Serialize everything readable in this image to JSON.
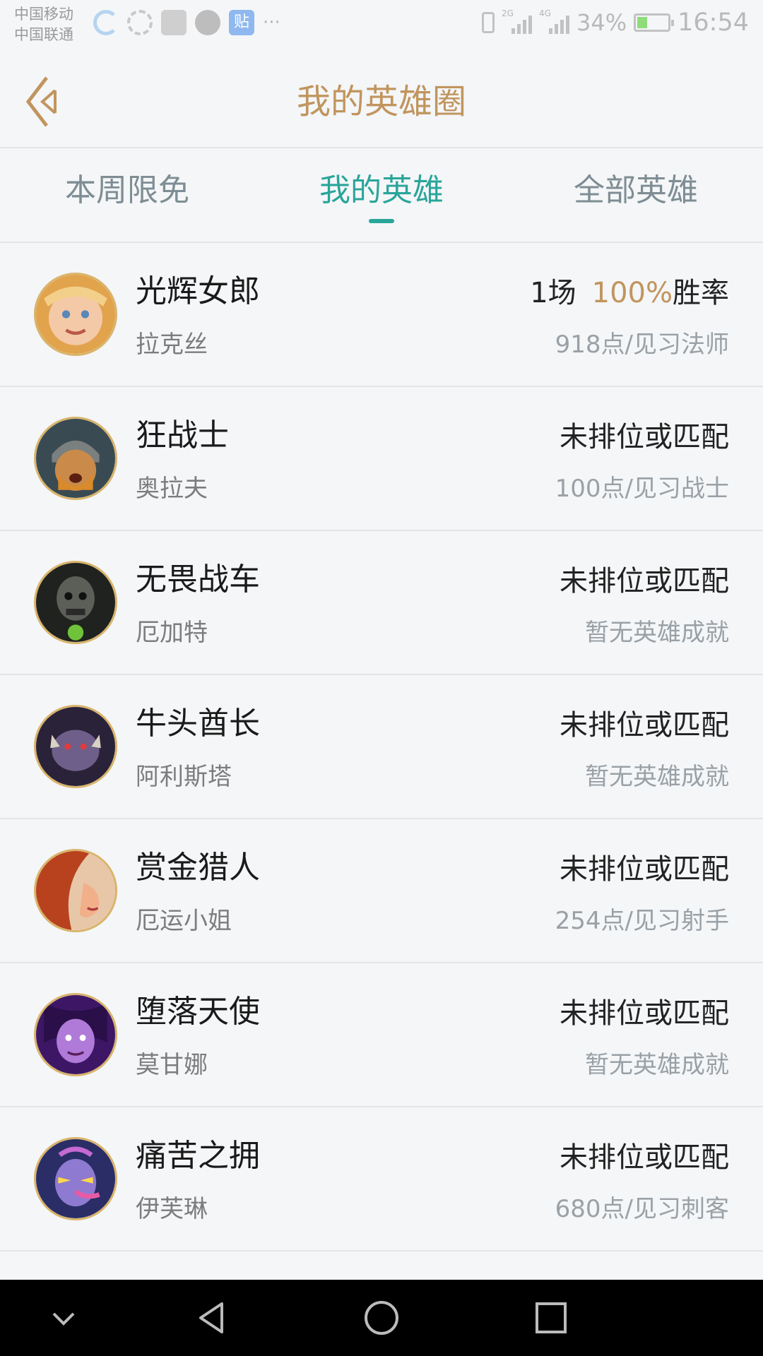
{
  "status_bar": {
    "carrier_1": "中国移动",
    "carrier_2": "中国联通",
    "more": "···",
    "notif_e": "贴",
    "network_2g": "2G",
    "network_4g": "4G",
    "battery": "34%",
    "battery_level": 0.34,
    "time": "16:54"
  },
  "header": {
    "title": "我的英雄圈"
  },
  "tabs": [
    {
      "label": "本周限免",
      "active": false
    },
    {
      "label": "我的英雄",
      "active": true
    },
    {
      "label": "全部英雄",
      "active": false
    }
  ],
  "heroes": [
    {
      "title": "光辉女郎",
      "name": "拉克丝",
      "games": "1场",
      "win_pct": "100%",
      "win_label": "胜率",
      "achievement": "918点/见习法师",
      "avatar_colors": [
        "#f3c9a7",
        "#e2a34d"
      ]
    },
    {
      "title": "狂战士",
      "name": "奥拉夫",
      "status": "未排位或匹配",
      "achievement": "100点/见习战士",
      "avatar_colors": [
        "#8a6b3a",
        "#d98a2b"
      ]
    },
    {
      "title": "无畏战车",
      "name": "厄加特",
      "status": "未排位或匹配",
      "achievement": "暂无英雄成就",
      "avatar_colors": [
        "#2d302a",
        "#5d7d2a"
      ]
    },
    {
      "title": "牛头酋长",
      "name": "阿利斯塔",
      "status": "未排位或匹配",
      "achievement": "暂无英雄成就",
      "avatar_colors": [
        "#3b2f4f",
        "#7a6a9a"
      ]
    },
    {
      "title": "赏金猎人",
      "name": "厄运小姐",
      "status": "未排位或匹配",
      "achievement": "254点/见习射手",
      "avatar_colors": [
        "#b8421e",
        "#f1b08a"
      ]
    },
    {
      "title": "堕落天使",
      "name": "莫甘娜",
      "status": "未排位或匹配",
      "achievement": "暂无英雄成就",
      "avatar_colors": [
        "#3d1766",
        "#b07ad9"
      ]
    },
    {
      "title": "痛苦之拥",
      "name": "伊芙琳",
      "status": "未排位或匹配",
      "achievement": "680点/见习刺客",
      "avatar_colors": [
        "#2a2d66",
        "#c56ad1"
      ]
    }
  ],
  "icons": {
    "back": "chevron-left-icon",
    "nav_down": "chevron-down-icon",
    "nav_back": "triangle-back-icon",
    "nav_home": "circle-home-icon",
    "nav_recent": "square-recent-icon"
  },
  "colors": {
    "accent_gold": "#c1955e",
    "accent_teal": "#2aa59a",
    "background": "#f4f6f8"
  }
}
